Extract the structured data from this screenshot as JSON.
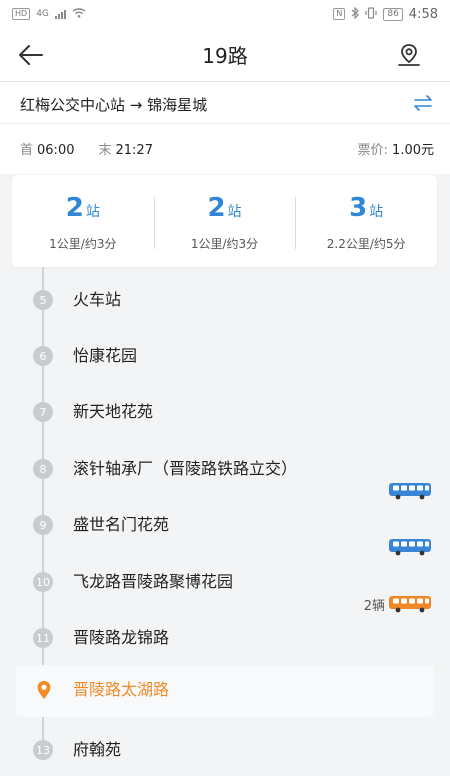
{
  "status_bar": {
    "hd": "HD",
    "net": "4G",
    "battery": "86",
    "time": "4:58"
  },
  "nav": {
    "title": "19路"
  },
  "route": {
    "from": "红梅公交中心站",
    "arrow": "→",
    "to": "锦海星城",
    "first_label": "首",
    "first_time": "06:00",
    "last_label": "末",
    "last_time": "21:27",
    "fare_label": "票价:",
    "fare_value": "1.00元"
  },
  "stats": [
    {
      "count": "2",
      "unit": "站",
      "detail": "1公里/约3分"
    },
    {
      "count": "2",
      "unit": "站",
      "detail": "1公里/约3分"
    },
    {
      "count": "3",
      "unit": "站",
      "detail": "2.2公里/约5分"
    }
  ],
  "stations": [
    {
      "num": "5",
      "name": "火车站",
      "bus": null
    },
    {
      "num": "6",
      "name": "怡康花园",
      "bus": null
    },
    {
      "num": "7",
      "name": "新天地花苑",
      "bus": null
    },
    {
      "num": "8",
      "name": "滚针轴承厂（晋陵路铁路立交）",
      "bus": "blue"
    },
    {
      "num": "9",
      "name": "盛世名门花苑",
      "bus": "blue"
    },
    {
      "num": "10",
      "name": "飞龙路晋陵路聚博花园",
      "bus": "orange",
      "bus_count": "2辆"
    },
    {
      "num": "11",
      "name": "晋陵路龙锦路",
      "bus": null
    },
    {
      "num": "",
      "name": "晋陵路太湖路",
      "bus": null,
      "current": true
    },
    {
      "num": "13",
      "name": "府翰苑",
      "bus": null
    }
  ],
  "colors": {
    "accent_blue": "#2f86d4",
    "accent_orange": "#f08c2a",
    "bus_blue": "#3a86d6",
    "bus_orange": "#f0882a"
  },
  "icons": {
    "back": "arrow-left-icon",
    "locate": "map-pin-icon",
    "swap": "swap-direction-icon",
    "current": "location-pin-icon",
    "bus": "bus-icon"
  }
}
